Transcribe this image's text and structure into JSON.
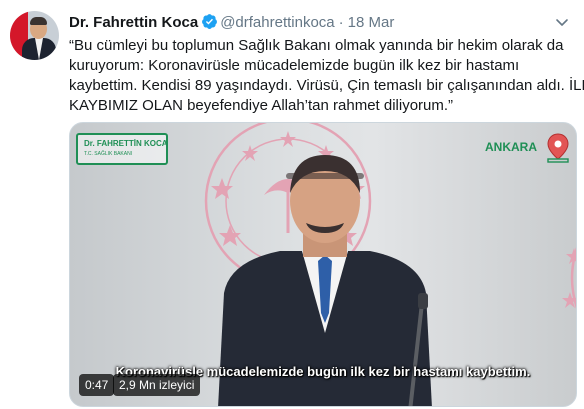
{
  "tweet": {
    "author_name": "Dr. Fahrettin Koca",
    "handle": "@drfahrettinkoca",
    "separator": "·",
    "date": "18 Mar",
    "text_lines": [
      "“Bu cümleyi bu toplumun Sağlık Bakanı olmak yanında bir hekim olarak da",
      "kuruyorum: Koronavirüsle mücadelemizde bugün ilk kez bir hastamı",
      "kaybettim. Kendisi 89 yaşındaydı. Virüsü, Çin temaslı bir çalışanından aldı. İLK",
      "KAYBIMIZ OLAN beyefendiye Allah’tan rahmet diliyorum.”"
    ]
  },
  "video": {
    "logo_name": "Dr. FAHRETTİN KOCA",
    "logo_subtitle": "T.C. SAĞLIK BAKANI",
    "location": "ANKARA",
    "subtitle": "Koronavirüsle mücadelemizde bugün ilk kez bir hastamı kaybettim.",
    "elapsed_time": "0:47",
    "views": "2,9 Mn izleyici"
  },
  "colors": {
    "verified_blue": "#1da1f2",
    "muted_text": "#657786",
    "emblem_red": "#e3a3b4",
    "brand_green": "#1f8f55"
  },
  "icons": {
    "verified": "verified-badge-icon",
    "more": "chevron-down-icon",
    "location_pin": "map-pin-icon"
  }
}
